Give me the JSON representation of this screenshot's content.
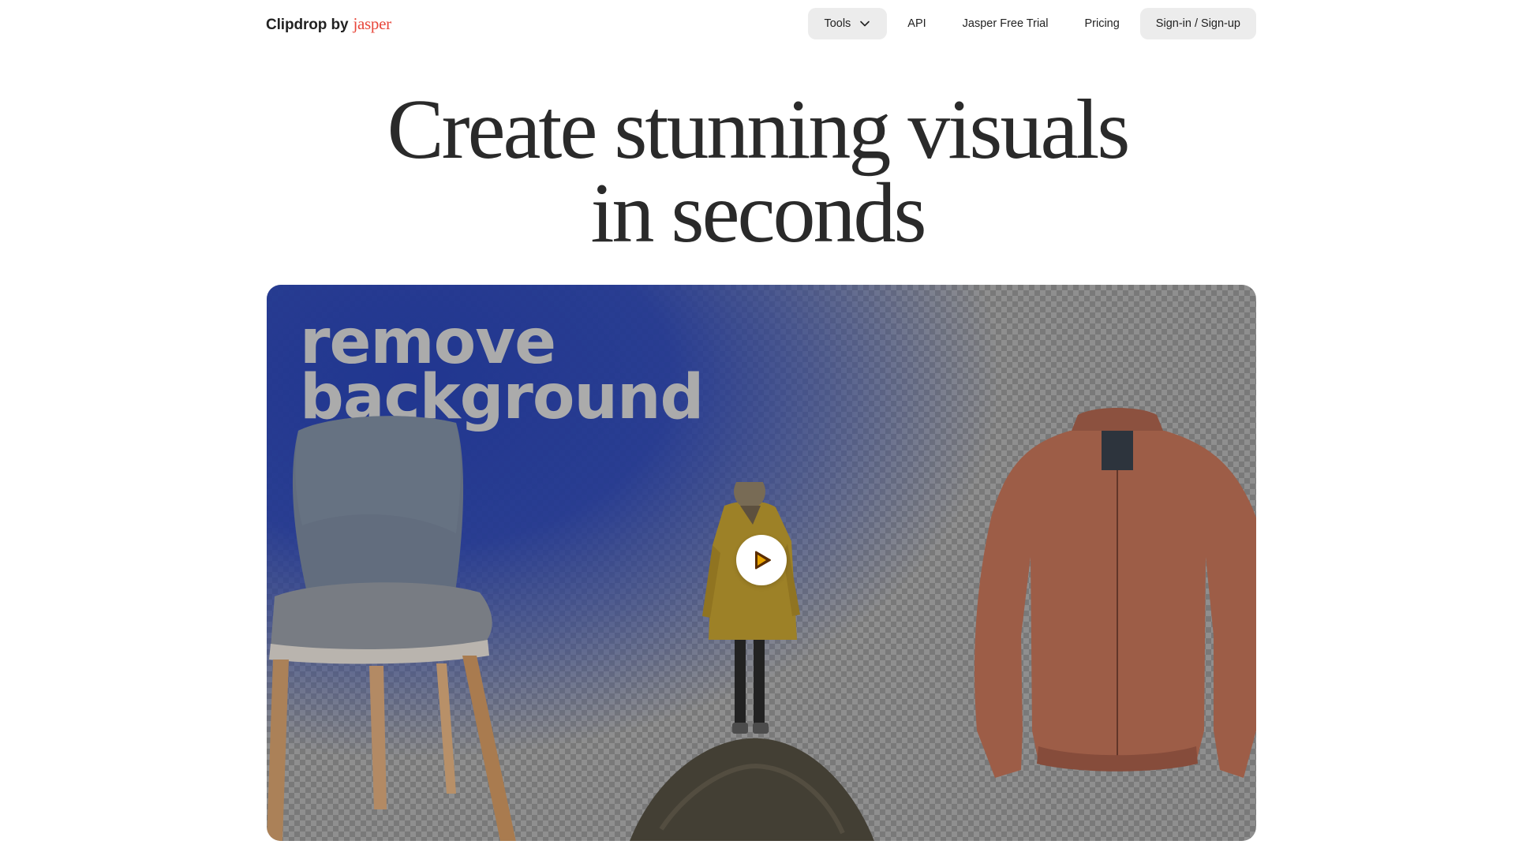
{
  "header": {
    "logo_main": "Clipdrop by",
    "logo_brand": "jasper",
    "nav": {
      "tools": "Tools",
      "api": "API",
      "trial": "Jasper Free Trial",
      "pricing": "Pricing",
      "signin": "Sign-in / Sign-up"
    }
  },
  "hero": {
    "title_line1": "Create stunning visuals",
    "title_line2": "in seconds"
  },
  "video": {
    "overlay_line1": "remove",
    "overlay_line2": "background",
    "play_icon": "play-icon"
  },
  "colors": {
    "brand": "#e8473b",
    "pill_bg": "#ececec",
    "text": "#222222"
  }
}
